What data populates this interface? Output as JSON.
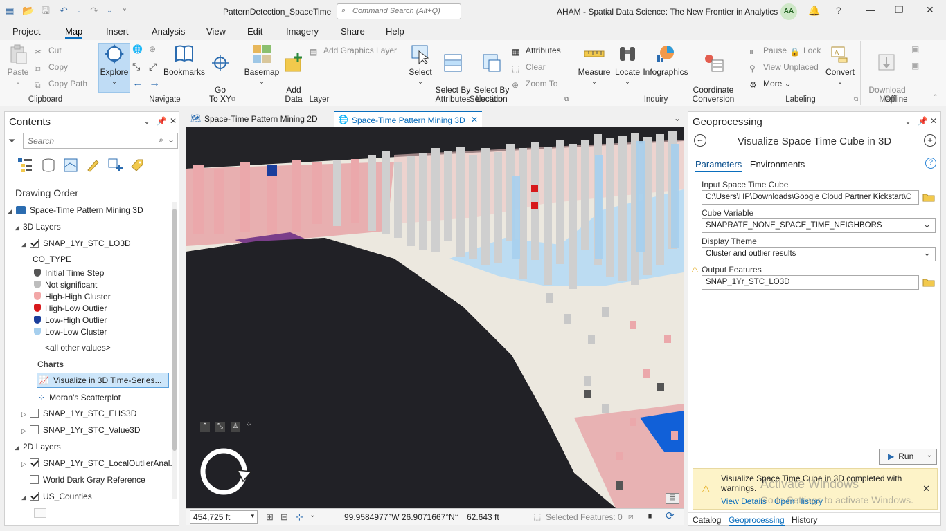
{
  "window": {
    "doc_title": "PatternDetection_SpaceTime",
    "command_search_placeholder": "Command Search (Alt+Q)",
    "project_title": "AHAM - Spatial Data Science:  The New Frontier in Analytics",
    "user_initials": "AA"
  },
  "ribbon_tabs": [
    "Project",
    "Map",
    "Insert",
    "Analysis",
    "View",
    "Edit",
    "Imagery",
    "Share",
    "Help"
  ],
  "active_tab": "Map",
  "ribbon": {
    "clipboard": {
      "label": "Clipboard",
      "paste": "Paste",
      "cut": "Cut",
      "copy": "Copy",
      "copy_path": "Copy Path"
    },
    "navigate": {
      "label": "Navigate",
      "explore": "Explore",
      "bookmarks": "Bookmarks",
      "goto": "Go\nTo XY"
    },
    "layer": {
      "label": "Layer",
      "basemap": "Basemap",
      "add_data": "Add\nData",
      "add_graphics": "Add Graphics Layer"
    },
    "selection": {
      "label": "Selection",
      "select": "Select",
      "select_by_attr": "Select By\nAttributes",
      "select_by_loc": "Select By\nLocation",
      "attributes": "Attributes",
      "clear": "Clear",
      "zoom_to": "Zoom To"
    },
    "inquiry": {
      "label": "Inquiry",
      "measure": "Measure",
      "locate": "Locate",
      "infographics": "Infographics",
      "coord": "Coordinate\nConversion"
    },
    "labeling": {
      "label": "Labeling",
      "pause": "Pause",
      "lock": "Lock",
      "view_unplaced": "View Unplaced",
      "more": "More",
      "convert": "Convert"
    },
    "offline": {
      "label": "Offline",
      "download": "Download\nMap"
    }
  },
  "contents": {
    "title": "Contents",
    "search_placeholder": "Search",
    "drawing_order": "Drawing Order",
    "map_name": "Space-Time Pattern Mining 3D",
    "layers_3d": "3D Layers",
    "layer1": "SNAP_1Yr_STC_LO3D",
    "field": "CO_TYPE",
    "legend": [
      {
        "label": "Initial Time Step",
        "color": "#555555"
      },
      {
        "label": "Not significant",
        "color": "#bdbdbd"
      },
      {
        "label": "High-High Cluster",
        "color": "#f2a7a7"
      },
      {
        "label": "High-Low Outlier",
        "color": "#d7191c"
      },
      {
        "label": "Low-High Outlier",
        "color": "#1a3e9c"
      },
      {
        "label": "Low-Low Cluster",
        "color": "#a6cfee"
      }
    ],
    "other_values": "<all other values>",
    "charts_label": "Charts",
    "chart1": "Visualize in 3D Time-Series...",
    "chart2": "Moran's Scatterplot",
    "layer2": "SNAP_1Yr_STC_EHS3D",
    "layer3": "SNAP_1Yr_STC_Value3D",
    "layers_2d": "2D Layers",
    "layer4": "SNAP_1Yr_STC_LocalOutlierAnal...",
    "layer5": "World Dark Gray Reference",
    "layer6": "US_Counties"
  },
  "map": {
    "tab1": "Space-Time Pattern Mining 2D",
    "tab2": "Space-Time Pattern Mining 3D",
    "scale": "454,725 ft",
    "coords": "99.9584977°W 26.9071667°N",
    "elevation": "62.643 ft",
    "selected": "Selected Features: 0"
  },
  "geoprocessing": {
    "title": "Geoprocessing",
    "tool": "Visualize Space Time Cube in 3D",
    "tab_params": "Parameters",
    "tab_env": "Environments",
    "input_label": "Input Space Time Cube",
    "input_value": "C:\\Users\\HP\\Downloads\\Google Cloud Partner Kickstart\\C",
    "cube_label": "Cube Variable",
    "cube_value": "SNAPRATE_NONE_SPACE_TIME_NEIGHBORS",
    "theme_label": "Display Theme",
    "theme_value": "Cluster and outlier results",
    "output_label": "Output Features",
    "output_value": "SNAP_1Yr_STC_LO3D",
    "run": "Run",
    "message": "Visualize Space Time Cube in 3D completed with warnings.",
    "view_details": "View Details",
    "open_history": "Open History",
    "bottom_tabs": [
      "Catalog",
      "Geoprocessing",
      "History"
    ]
  },
  "watermark": {
    "line1": "Activate Windows",
    "line2": "Go to Settings to activate Windows."
  }
}
